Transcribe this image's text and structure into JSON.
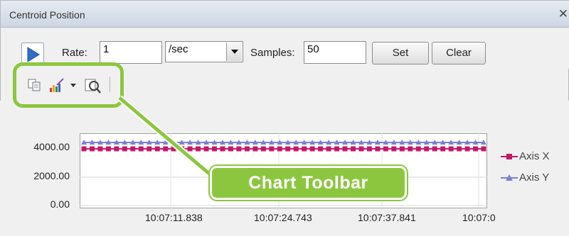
{
  "window": {
    "title": "Centroid Position",
    "close_symbol": "✕"
  },
  "controls": {
    "rate_label": "Rate:",
    "rate_value": "1",
    "rate_unit": "/sec",
    "samples_label": "Samples:",
    "samples_value": "50",
    "set_label": "Set",
    "clear_label": "Clear"
  },
  "toolbar": {
    "icons": [
      "copy-icon",
      "palette-icon",
      "dropdown-arrow-icon",
      "zoom-icon"
    ]
  },
  "chart_data": {
    "type": "line",
    "x": [
      "10:07:11.838",
      "10:07:24.743",
      "10:07:37.841",
      "10:07:0"
    ],
    "y_ticks": [
      "4000.00",
      "2000.00",
      "0.00"
    ],
    "ylim": [
      0,
      5000
    ],
    "series": [
      {
        "name": "Axis X",
        "value": 4000,
        "color": "#c2186b",
        "marker": "square"
      },
      {
        "name": "Axis Y",
        "value": 4450,
        "color": "#7a7fd6",
        "marker": "triangle"
      }
    ],
    "points_per_series": 50,
    "grid": true,
    "legend": "right"
  },
  "callout": {
    "label": "Chart Toolbar",
    "color": "#8cc63f"
  }
}
